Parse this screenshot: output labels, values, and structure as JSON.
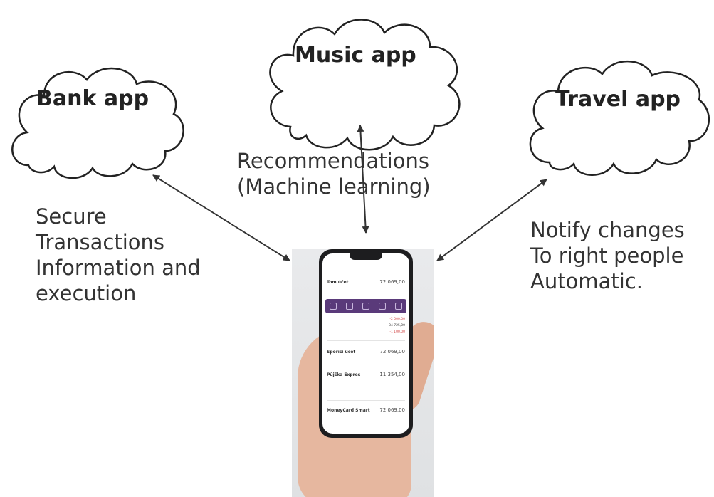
{
  "clouds": {
    "bank": "Bank app",
    "music": "Music app",
    "travel": "Travel app"
  },
  "notes": {
    "music": [
      "Recommendations",
      "(Machine learning)"
    ],
    "bank": [
      "Secure",
      "Transactions",
      "Information and",
      "execution"
    ],
    "travel": [
      "Notify changes",
      "To right people",
      "Automatic."
    ]
  },
  "phone_screen": {
    "account1_title": "Tom účet",
    "account1_amount": "72 069,00",
    "tx1": "-2 000,00",
    "tx2": "34 725,00",
    "tx3": "-1 100,00",
    "account2_title": "Spořicí účet",
    "account2_amount": "72 069,00",
    "account3_title": "Půjčka Expres",
    "account3_amount": "11 354,00",
    "account4_title": "MoneyCard Smart",
    "account4_amount": "72 069,00"
  },
  "colors": {
    "arrow": "#333333",
    "cloud_stroke": "#222222",
    "phone_bar": "#5a3a7a"
  }
}
